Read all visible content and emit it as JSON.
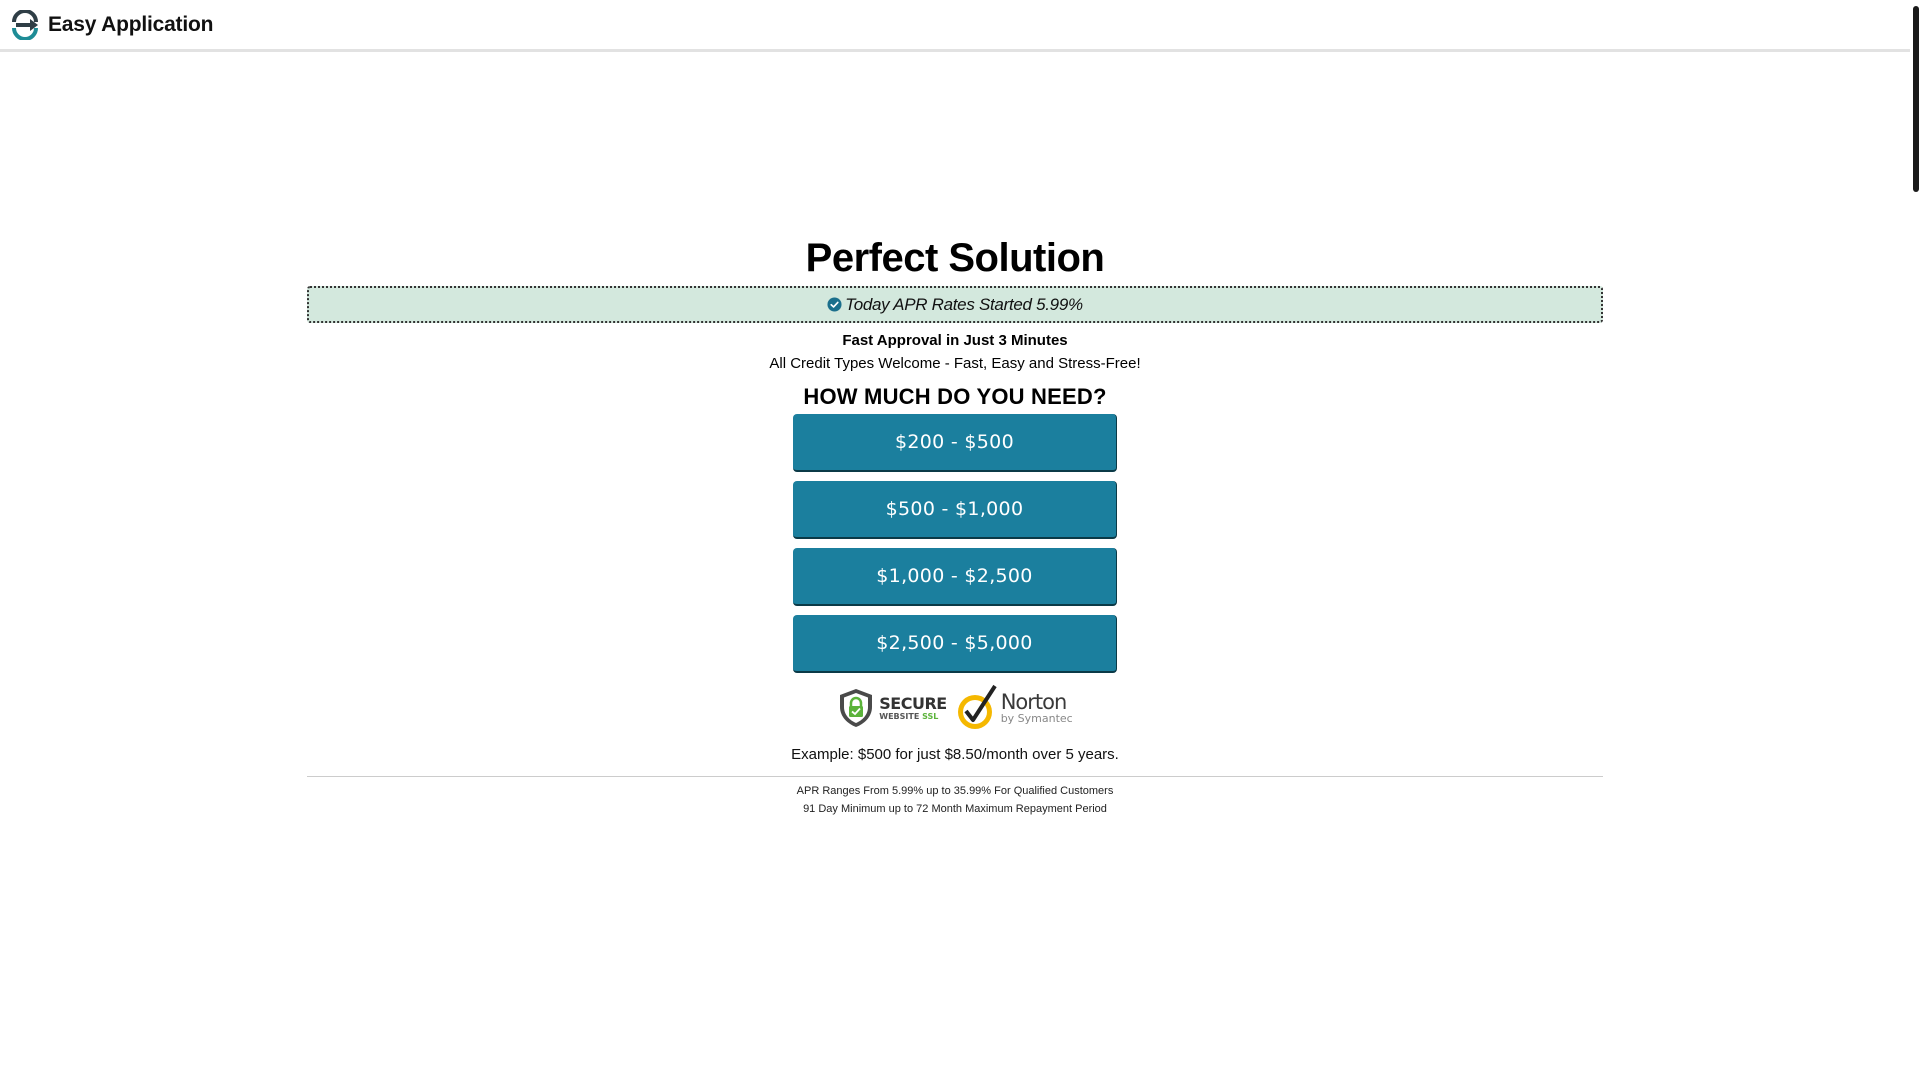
{
  "header": {
    "brand": "Easy Application",
    "logo_icon": "arrow-circle-logo-icon"
  },
  "main": {
    "title": "Perfect Solution",
    "apr_banner": "Today APR Rates Started 5.99%",
    "fast_approval": "Fast Approval in Just 3 Minutes",
    "credit_types": "All Credit Types Welcome - Fast, Easy and Stress-Free!",
    "question": "HOW MUCH DO YOU NEED?",
    "amounts": [
      "$200 - $500",
      "$500 - $1,000",
      "$1,000 - $2,500",
      "$2,500 - $5,000"
    ],
    "badges": {
      "ssl_big": "SECURE",
      "ssl_small_website": "WEBSITE",
      "ssl_small_ssl": "SSL",
      "norton_big": "Norton",
      "norton_small": "by Symantec"
    },
    "example": "Example: $500 for just $8.50/month over 5 years.",
    "fine_print": [
      "APR Ranges From 5.99% up to 35.99% For Qualified Customers",
      "91 Day Minimum up to 72 Month Maximum Repayment Period"
    ]
  },
  "colors": {
    "button": "#1b7f9e",
    "banner": "#d3e8dd",
    "logo_teal": "#1e8c96",
    "logo_dark": "#2f3e46",
    "ssl_green": "#5bb33a",
    "norton_yellow": "#f5b800"
  }
}
